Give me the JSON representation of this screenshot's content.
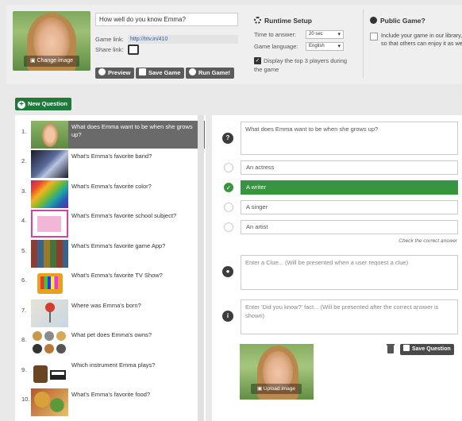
{
  "setup": {
    "change_image_label": "Change image",
    "game_title": "How well do you know Emma?",
    "game_link_label": "Game link:",
    "game_link_value": "http://triv.in/410",
    "share_link_label": "Share link:",
    "preview_label": "Preview",
    "save_game_label": "Save Game",
    "run_game_label": "Run Game!"
  },
  "runtime": {
    "title": "Runtime Setup",
    "time_label": "Time to answer:",
    "time_value": "20 sec",
    "language_label": "Game language:",
    "language_value": "English",
    "top3_label_line1": "Display the top 3 players during",
    "top3_label_line2": "the game"
  },
  "public_game": {
    "title": "Public Game?",
    "text_line1": "Include your game in our library,",
    "text_line2": "so that others can enjoy it as we"
  },
  "new_question_label": "New Question",
  "questions": [
    {
      "num": "1.",
      "text": "What does Emma want to be when she grows up?",
      "thumb": "girl-photo"
    },
    {
      "num": "2.",
      "text": "What's Emma's favorite band?",
      "thumb": "band-photo"
    },
    {
      "num": "3.",
      "text": "What's Emma's favorite color?",
      "thumb": "rainbow-photo"
    },
    {
      "num": "4.",
      "text": "What's Emma's favorite school subject?",
      "thumb": "school-photo"
    },
    {
      "num": "5.",
      "text": "What's Emma's favorite game App?",
      "thumb": "apps-photo"
    },
    {
      "num": "6.",
      "text": "What's Emma's favorite TV Show?",
      "thumb": "tv-photo"
    },
    {
      "num": "7.",
      "text": "Where was Emma's born?",
      "thumb": "map-pin-photo"
    },
    {
      "num": "8.",
      "text": "What pet does Emma's owns?",
      "thumb": "pets-photo"
    },
    {
      "num": "9.",
      "text": "Which instrument Emma plays?",
      "thumb": "instruments-photo"
    },
    {
      "num": "10.",
      "text": "What's Emma's favorite food?",
      "thumb": "food-photo"
    }
  ],
  "editor": {
    "question_text": "What does Emma want to be when she grows up?",
    "answers": [
      "An actress",
      "A writer",
      "A singer",
      "An artist"
    ],
    "correct_index": 1,
    "check_hint": "Check the correct answer",
    "clue_placeholder": "Enter a Clue... (Will be presented when a user request a clue)",
    "fact_placeholder": "Enter 'Did you know?' fact... (Will be presented after the correct answer is shown)",
    "upload_label": "Upload image",
    "save_question_label": "Save Question"
  },
  "colors": {
    "accent_green": "#37953f",
    "new_question_green": "#1f7a3a",
    "selected_row": "#6a6a6a"
  }
}
